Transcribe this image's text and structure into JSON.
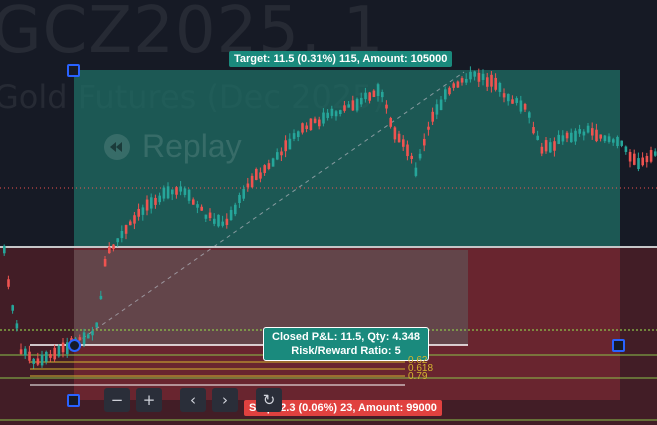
{
  "watermark": {
    "symbol": "GCZ2025, 1",
    "name": "Gold Futures (Dec 2025)",
    "replay": "Replay"
  },
  "position": {
    "target_label": "Target: 11.5 (0.31%) 115, Amount: 105000",
    "stop_label": "Stop: 2.3 (0.06%) 23, Amount: 99000",
    "pnl_line1": "Closed P&L: 11.5, Qty: 4.348",
    "pnl_line2": "Risk/Reward Ratio: 5"
  },
  "fib_levels": [
    "0.62",
    "0.618",
    "0.79"
  ],
  "toolbar": {
    "zoom_out": "−",
    "zoom_in": "+",
    "scroll_left": "‹",
    "scroll_right": "›",
    "reset": "↻"
  },
  "colors": {
    "background": "#161a25",
    "profit_zone": "#1f6e64",
    "loss_zone": "#7a2a33",
    "up_candle": "#26a69a",
    "down_candle": "#ef5350",
    "level_line": "#8bc34a",
    "fib": "#d4b52f",
    "handle": "#2962ff"
  }
}
